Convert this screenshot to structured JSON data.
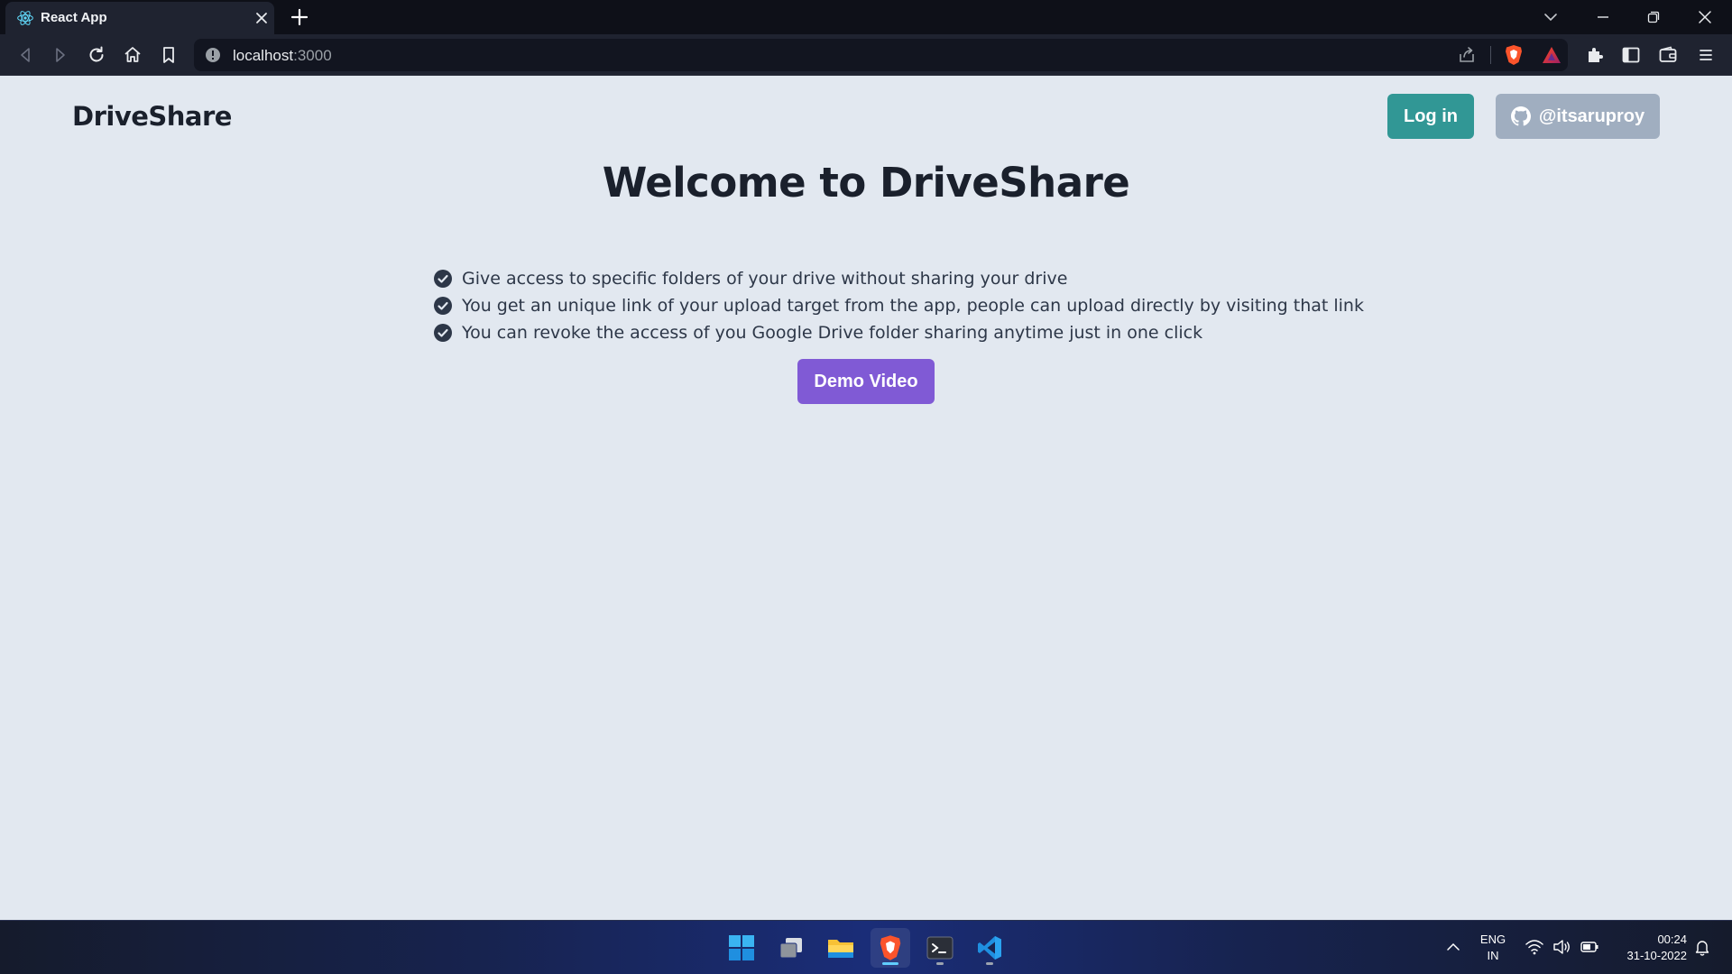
{
  "browser": {
    "tab_title": "React App",
    "url_host": "localhost",
    "url_port": ":3000"
  },
  "page": {
    "brand": "DriveShare",
    "login_label": "Log in",
    "github_label": "@itsaruproy",
    "heading": "Welcome to DriveShare",
    "features": [
      "Give access to specific folders of your drive without sharing your drive",
      "You get an unique link of your upload target from the app, people can upload directly by visiting that link",
      "You can revoke the access of you Google Drive folder sharing anytime just in one click"
    ],
    "demo_label": "Demo Video",
    "colors": {
      "background": "#e2e8f0",
      "login_button": "#319795",
      "github_button": "#a0aec0",
      "demo_button": "#805ad5",
      "text": "#1a202c"
    }
  },
  "taskbar": {
    "apps": [
      "windows-start-icon",
      "task-view-icon",
      "file-explorer-icon",
      "brave-browser-icon",
      "terminal-icon",
      "vscode-icon"
    ],
    "lang_line1": "ENG",
    "lang_line2": "IN",
    "time": "00:24",
    "date": "31-10-2022"
  }
}
